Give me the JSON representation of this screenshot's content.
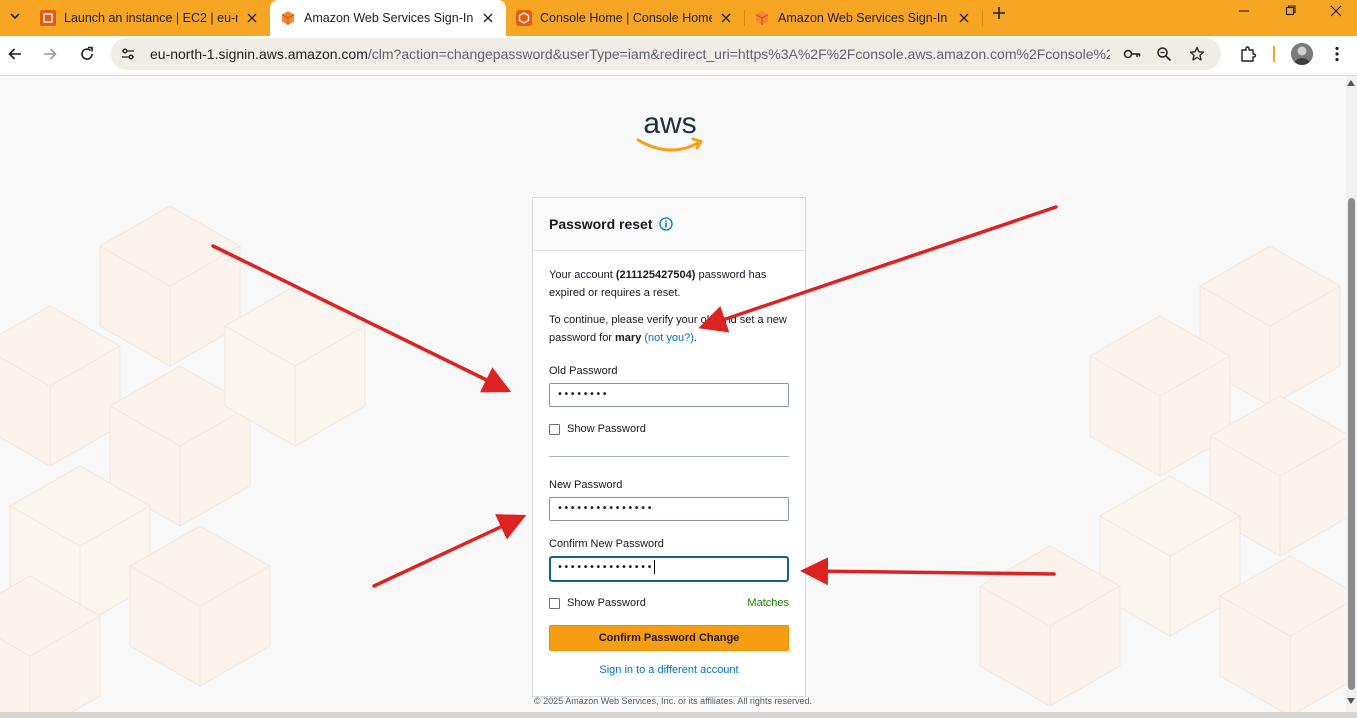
{
  "browser": {
    "tabs": [
      {
        "title": "Launch an instance | EC2 | eu-no",
        "active": false
      },
      {
        "title": "Amazon Web Services Sign-In",
        "active": true
      },
      {
        "title": "Console Home | Console Home",
        "active": false
      },
      {
        "title": "Amazon Web Services Sign-In",
        "active": false
      }
    ],
    "url_host": "eu-north-1.signin.aws.amazon.com",
    "url_rest": "/clm?action=changepassword&userType=iam&redirect_uri=https%3A%2F%2Fconsole.aws.amazon.com%2Fconsole%2..."
  },
  "page": {
    "logo_text": "aws",
    "card": {
      "title": "Password reset",
      "intro_prefix": "Your account ",
      "account_id": "(211125427504)",
      "intro_suffix": " password has expired or requires a reset.",
      "verify_prefix": "To continue, please verify your old and set a new password for ",
      "username": "mary",
      "not_you_link": "(not you?)",
      "verify_end": "."
    },
    "form": {
      "old_password_label": "Old Password",
      "old_password_value": "••••••••",
      "show_password_label_1": "Show Password",
      "new_password_label": "New Password",
      "new_password_value": "•••••••••••••••",
      "confirm_password_label": "Confirm New Password",
      "confirm_password_value": "•••••••••••••••",
      "show_password_label_2": "Show Password",
      "match_status": "Matches",
      "confirm_button": "Confirm Password Change",
      "alt_link": "Sign in to a different account"
    },
    "footer": "© 2025 Amazon Web Services, Inc. or its affiliates. All rights reserved."
  },
  "colors": {
    "tab_strip": "#f6a623",
    "aws_orange": "#f79d13",
    "link": "#0073bb",
    "match_green": "#1d8102",
    "annotation_red": "#dd2222"
  },
  "icons": [
    "tab-search-icon",
    "launch-favicon",
    "aws-cube-favicon",
    "console-favicon",
    "close-icon",
    "new-tab-icon",
    "minimize-icon",
    "maximize-icon",
    "window-close-icon",
    "back-icon",
    "forward-icon",
    "reload-icon",
    "site-settings-icon",
    "password-key-icon",
    "zoom-icon",
    "bookmark-star-icon",
    "extensions-icon",
    "profile-avatar",
    "menu-kebab-icon",
    "info-icon"
  ]
}
